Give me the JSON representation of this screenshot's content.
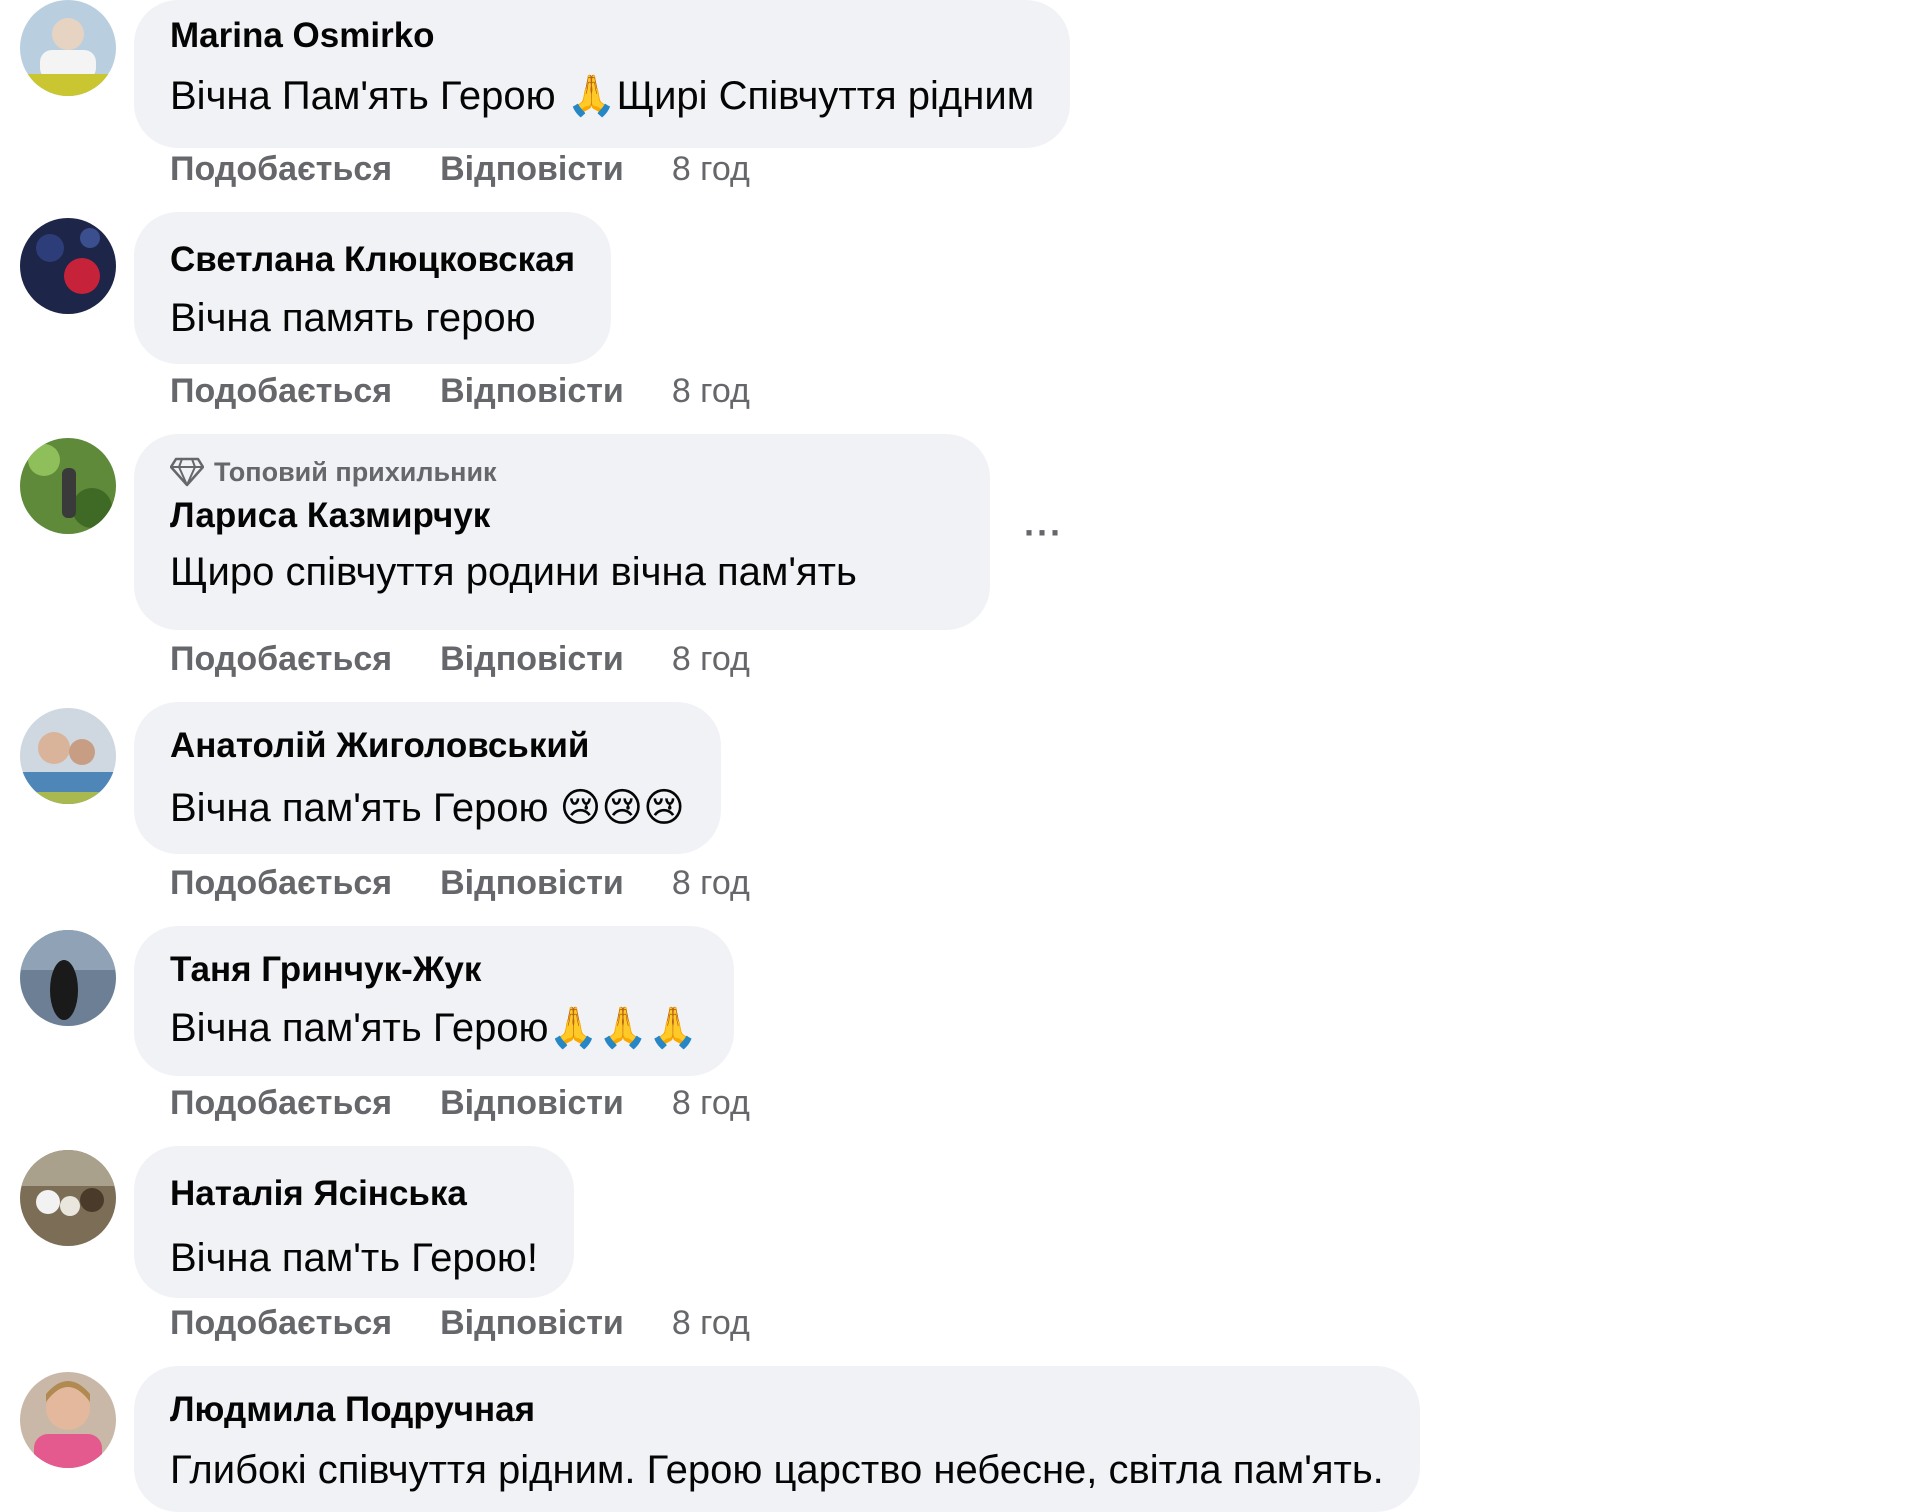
{
  "actions": {
    "like_label": "Подобається",
    "reply_label": "Відповісти"
  },
  "comments": [
    {
      "author": "Marina Osmirko",
      "text": "Вічна Пам'ять Герою 🙏Щирі Співчуття рідним",
      "time": "8 год"
    },
    {
      "author": "Светлана Клюцковская",
      "text": "Вічна память герою",
      "time": "8 год"
    },
    {
      "badge": "Топовий прихильник",
      "badge_icon": "diamond-icon",
      "author": "Лариса Казмирчук",
      "text": "Щиро співчуття родини вічна пам'ять",
      "time": "8 год",
      "more_label": "···"
    },
    {
      "author": "Анатолій Жиголовський",
      "text": "Вічна пам'ять Герою 😢😢😢",
      "time": "8 год"
    },
    {
      "author": "Таня Гринчук-Жук",
      "text": "Вічна пам'ять Герою🙏🙏🙏",
      "time": "8 год"
    },
    {
      "author": "Наталія Ясінська",
      "text": "Вічна пам'ть Герою!",
      "time": "8 год"
    },
    {
      "author": "Людмила Подручная",
      "text": "Глибокі співчуття рідним. Герою царство небесне, світла пам'ять.",
      "time": ""
    }
  ],
  "colors": {
    "bubble_bg": "#f0f2f5",
    "secondary_text": "#65676b",
    "primary_text": "#050505"
  }
}
